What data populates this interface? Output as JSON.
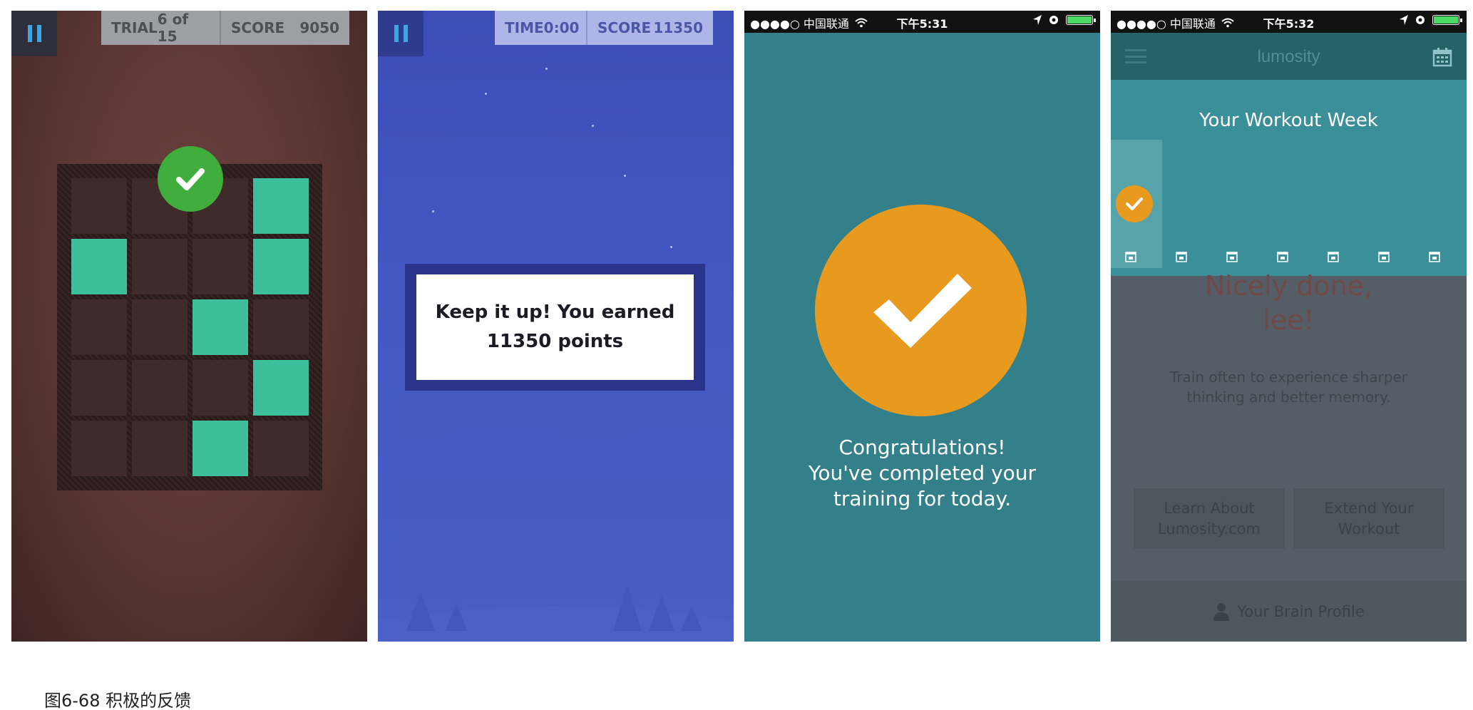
{
  "panel1": {
    "hud": {
      "trial_label": "TRIAL",
      "trial_value": "6 of 15",
      "score_label": "SCORE",
      "score_value": "9050"
    },
    "icons": {
      "pause": "pause-icon",
      "feedback": "checkmark-icon"
    },
    "grid": {
      "rows": 5,
      "cols": 4,
      "active_tiles": [
        [
          0,
          3
        ],
        [
          1,
          0
        ],
        [
          1,
          3
        ],
        [
          2,
          2
        ],
        [
          3,
          3
        ],
        [
          4,
          2
        ]
      ]
    },
    "colors": {
      "tile_on": "#3dbf9b",
      "check": "#3fae3c"
    }
  },
  "panel2": {
    "hud": {
      "time_label": "TIME",
      "time_value": "0:00",
      "score_label": "SCORE",
      "score_value": "11350"
    },
    "message": {
      "line1": "Keep it up! You earned",
      "line2": "11350 points"
    }
  },
  "panel3": {
    "status": {
      "carrier": "●●●●○ 中国联通",
      "time": "下午5:31"
    },
    "congrats": {
      "line1": "Congratulations!",
      "line2": "You've completed your",
      "line3": "training for today."
    },
    "colors": {
      "background": "#33808a",
      "accent": "#e89a1f"
    }
  },
  "panel4": {
    "status": {
      "carrier": "●●●●○ 中国联通",
      "time": "下午5:32"
    },
    "header": {
      "brand": "lumosity",
      "menu_icon": "menu-icon",
      "calendar_icon": "calendar-icon"
    },
    "week_title": "Your Workout Week",
    "day_count": 7,
    "completed_days": 1,
    "nicely_done": {
      "line1": "Nicely done,",
      "line2": "lee!"
    },
    "subtitle": {
      "line1": "Train often to experience sharper",
      "line2": "thinking and better memory."
    },
    "buttons": {
      "learn": {
        "line1": "Learn About",
        "line2": "Lumosity.com"
      },
      "extend": {
        "line1": "Extend Your",
        "line2": "Workout"
      }
    },
    "footer": {
      "label": "Your Brain Profile",
      "icon": "person-icon"
    }
  },
  "caption": "图6-68 积极的反馈"
}
